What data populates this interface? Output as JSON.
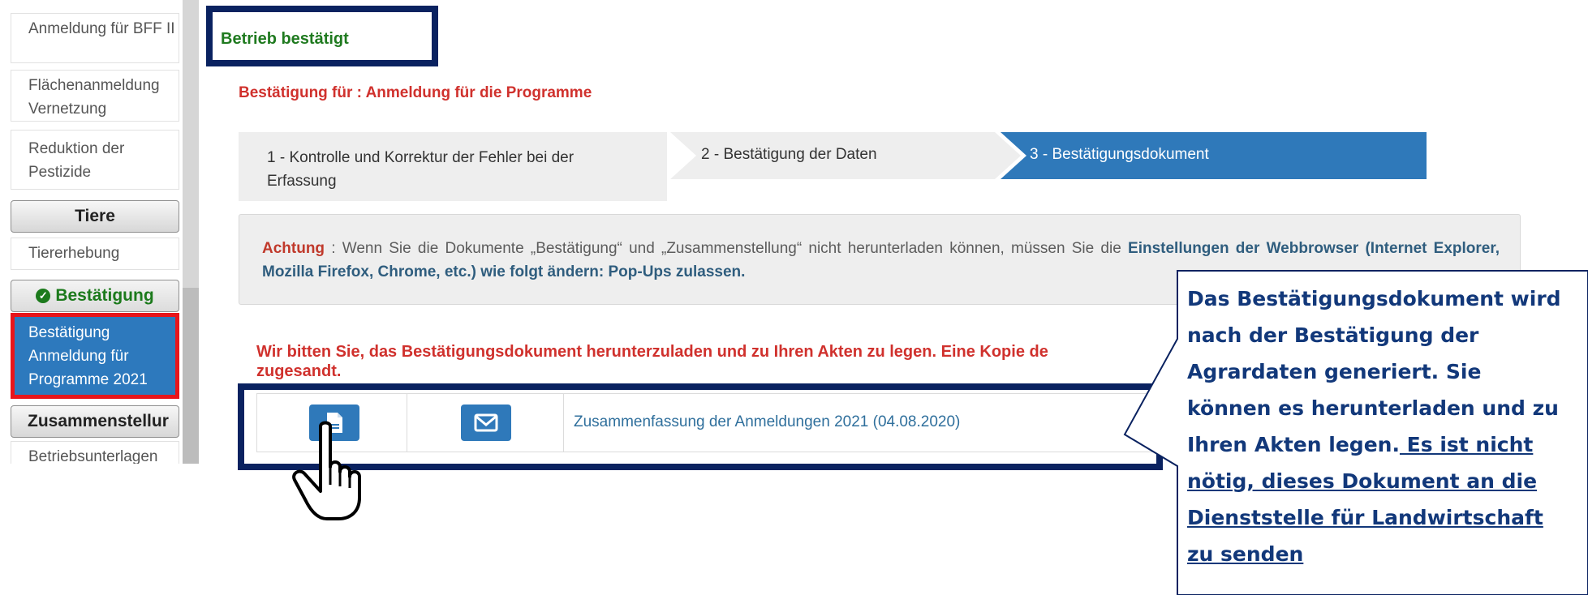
{
  "sidebar": {
    "items_top": [
      "Anmeldung für BFF II",
      "Flächenanmeldung Vernetzung",
      "Reduktion der Pestizide"
    ],
    "header_tiere": "Tiere",
    "item_tiere": "Tiererhebung",
    "header_bestaetigung": "Bestätigung",
    "active_item": "Bestätigung Anmeldung für Programme 2021",
    "header_zusammenstellung": "Zusammenstellur",
    "item_betrieb": "Betriebsunterlagen"
  },
  "main": {
    "title": "Betrieb bestätigt",
    "subtitle": "Bestätigung für : Anmeldung für die Programme",
    "steps": [
      {
        "label": "1 - Kontrolle und Korrektur der Fehler bei der Erfassung"
      },
      {
        "label": "2 - Bestätigung der Daten"
      },
      {
        "label": "3 - Bestätigungsdokument"
      }
    ],
    "alert": {
      "label": "Achtung",
      "text": " : Wenn Sie die Dokumente „Bestätigung“ und „Zusammenstellung“ nicht herunterladen können, müssen Sie die ",
      "bold": "Einstellungen der Webbrowser (Internet Explorer, Mozilla Firefox, Chrome, etc.) wie folgt ändern: Pop-Ups zulassen."
    },
    "notice": "Wir bitten Sie, das Bestätigungsdokument herunterzuladen und zu Ihren Akten zu legen. Eine Kopie de",
    "notice_line2": "zugesandt.",
    "document_row": {
      "download_icon": "file-icon",
      "email_icon": "envelope-icon",
      "link": "Zusammenfassung der Anmeldungen 2021 (04.08.2020)"
    }
  },
  "callout": {
    "text_plain": "Das Bestätigungsdokument wird nach der Bestätigung der Agrardaten generiert. Sie können es herunterladen und zu Ihren Akten legen.",
    "text_underlined": " Es ist nicht nötig, dieses Dokument an die Dienststelle für Landwirtschaft zu senden"
  },
  "colors": {
    "accent_blue": "#2f79ba",
    "highlight_navy": "#0a2260",
    "alert_red": "#d0312d",
    "success_green": "#1f7a1f"
  }
}
